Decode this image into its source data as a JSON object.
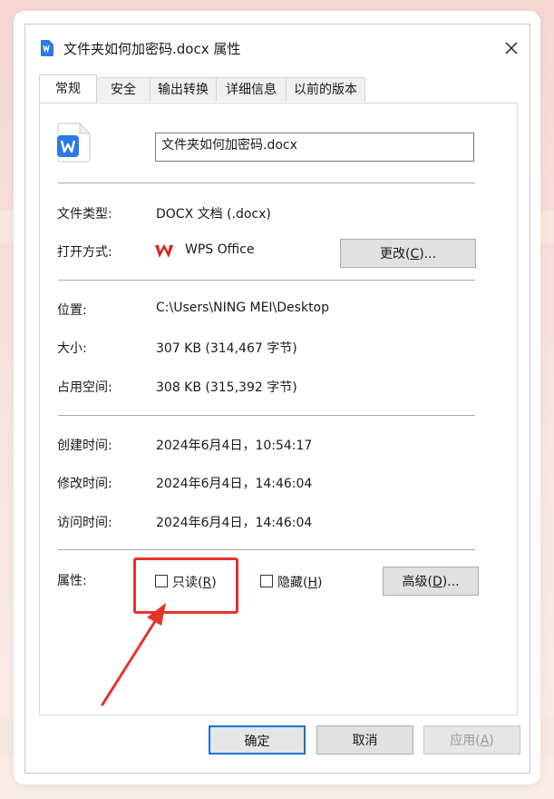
{
  "window": {
    "title": "文件夹如何加密码.docx 属性",
    "close_icon": "close-icon",
    "file_icon": "wps-writer-doc-icon"
  },
  "tabs": [
    {
      "label": "常规",
      "active": true
    },
    {
      "label": "安全"
    },
    {
      "label": "输出转换"
    },
    {
      "label": "详细信息"
    },
    {
      "label": "以前的版本"
    }
  ],
  "general": {
    "file_name": "文件夹如何加密码.docx",
    "type_label": "文件类型:",
    "type_value": "DOCX 文档 (.docx)",
    "open_with_label": "打开方式:",
    "open_with_value": "WPS Office",
    "change_button_prefix": "更改(",
    "change_button_key": "C",
    "change_button_suffix": ")...",
    "location_label": "位置:",
    "location_value": "C:\\Users\\NING MEI\\Desktop",
    "size_label": "大小:",
    "size_value": "307 KB (314,467 字节)",
    "size_on_disk_label": "占用空间:",
    "size_on_disk_value": "308 KB (315,392 字节)",
    "created_label": "创建时间:",
    "created_value": "2024年6月4日，10:54:17",
    "modified_label": "修改时间:",
    "modified_value": "2024年6月4日，14:46:04",
    "accessed_label": "访问时间:",
    "accessed_value": "2024年6月4日，14:46:04",
    "attributes_label": "属性:",
    "readonly_prefix": "只读(",
    "readonly_key": "R",
    "readonly_suffix": ")",
    "readonly_checked": false,
    "hidden_prefix": "隐藏(",
    "hidden_key": "H",
    "hidden_suffix": ")",
    "hidden_checked": false,
    "advanced_prefix": "高级(",
    "advanced_key": "D",
    "advanced_suffix": ")..."
  },
  "footer": {
    "ok_label": "确定",
    "cancel_label": "取消",
    "apply_prefix": "应用(",
    "apply_key": "A",
    "apply_suffix": ")"
  },
  "colors": {
    "highlight": "#e6332a",
    "accent": "#1f6fd1",
    "wps_red": "#d9251d",
    "doc_blue": "#2b79e6"
  }
}
